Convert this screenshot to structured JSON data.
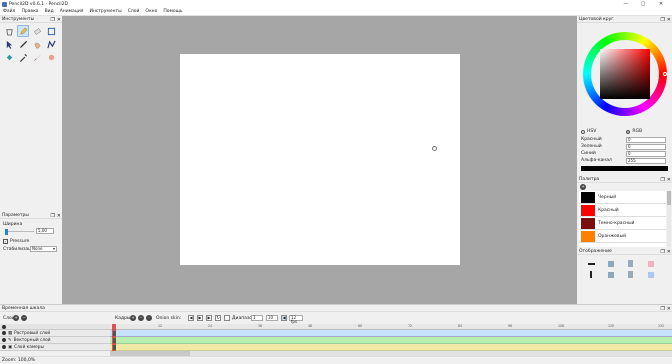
{
  "window": {
    "title": "Pencil2D v0.6.1 - Pencil2D",
    "minimize": "—",
    "maximize": "▢",
    "close": "✕"
  },
  "menu": [
    "Файл",
    "Правка",
    "Вид",
    "Анимация",
    "Инструменты",
    "Слой",
    "Окно",
    "Помощь"
  ],
  "tools_panel": {
    "title": "Инструменты",
    "icons": [
      "clear-icon",
      "pencil-icon",
      "eraser-icon",
      "select-icon",
      "pointer-icon",
      "pen-icon",
      "hand-icon",
      "polyline-icon",
      "bucket-icon",
      "eyedropper-icon",
      "brush-icon",
      "smudge-icon"
    ]
  },
  "options_panel": {
    "title": "Параметры",
    "width_label": "Ширина",
    "width_value": "5,00",
    "pressure_label": "Pressure",
    "stabilizer_label": "Стабилизация",
    "stabilizer_value": "None"
  },
  "color_wheel": {
    "title": "Цветовой круг",
    "hsv": "HSV",
    "rgb": "RGB",
    "red_label": "Красный",
    "red_value": "0",
    "green_label": "Зеленый",
    "green_value": "0",
    "blue_label": "Синий",
    "blue_value": "0",
    "alpha_label": "Альфа-канал",
    "alpha_value": "255",
    "current_color": "#000000"
  },
  "palette": {
    "title": "Палитра",
    "colors": [
      {
        "name": "Черный",
        "hex": "#000000"
      },
      {
        "name": "Красный",
        "hex": "#ff0000"
      },
      {
        "name": "Темно-красный",
        "hex": "#7a0d0d"
      },
      {
        "name": "Оранжевый",
        "hex": "#ff8000"
      }
    ]
  },
  "display": {
    "title": "Отображение"
  },
  "timeline": {
    "title": "Временная шкала",
    "layer_label": "Слои:",
    "keys_label": "Кадры:",
    "onion_label": "Onion skin:",
    "range_label": "Диапазон",
    "range_start": "1",
    "range_end": "10",
    "fps": "12 fps",
    "ticks": [
      "1",
      "12",
      "24",
      "36",
      "48",
      "60",
      "72",
      "84",
      "96",
      "108",
      "120",
      "132"
    ],
    "layers": [
      {
        "name": "Растровый слой",
        "color": "#c6e3fb"
      },
      {
        "name": "Векторный слой",
        "color": "#b8eeb0"
      },
      {
        "name": "Слой камеры",
        "color": "#f2e8a6"
      }
    ]
  },
  "status": {
    "zoom": "Zoom: 100,0%"
  }
}
